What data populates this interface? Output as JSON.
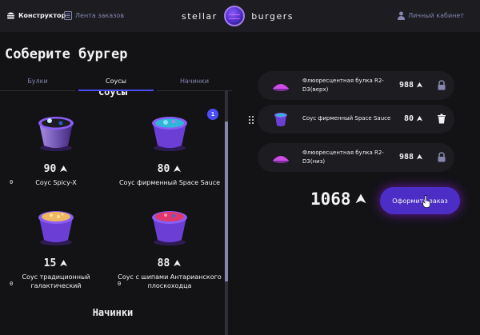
{
  "header": {
    "constructor_label": "Конструктор",
    "feed_label": "Лента заказов",
    "logo_left": "stellar",
    "logo_right": "burgers",
    "account_label": "Личный кабинет"
  },
  "page": {
    "title": "Соберите бургер"
  },
  "tabs": [
    {
      "label": "Булки",
      "active": false
    },
    {
      "label": "Соусы",
      "active": true
    },
    {
      "label": "Начинки",
      "active": false
    }
  ],
  "sections": {
    "sauces_heading": "Соусы",
    "fillings_heading": "Начинки"
  },
  "sauces": [
    {
      "price": "90",
      "name": "Соус Spicy-X",
      "counter": ""
    },
    {
      "price": "80",
      "name": "Соус фирменный Space Sauce",
      "counter": "1"
    },
    {
      "price": "15",
      "name": "Соус традиционный галактический",
      "counter": ""
    },
    {
      "price": "88",
      "name": "Соус с шипами Антарианского плоскоходца",
      "counter": ""
    }
  ],
  "zero_marks": [
    "0",
    "0",
    "0"
  ],
  "constructor": {
    "items": [
      {
        "name": "Флюоресцентная булка R2-D3(верх)",
        "price": "988",
        "icon": "lock-icon"
      },
      {
        "name": "Соус фирменный Space Sauce",
        "price": "80",
        "icon": "trash-icon"
      },
      {
        "name": "Флюоресцентная булка R2-D3(низ)",
        "price": "988",
        "icon": "lock-icon"
      }
    ],
    "total": "1068",
    "order_button": "Оформить заказ"
  },
  "colors": {
    "background": "#131316",
    "panel": "#1c1c21",
    "accent": "#4c4cff",
    "secondary_text": "#8585ad",
    "button": "#4c2ec7"
  }
}
